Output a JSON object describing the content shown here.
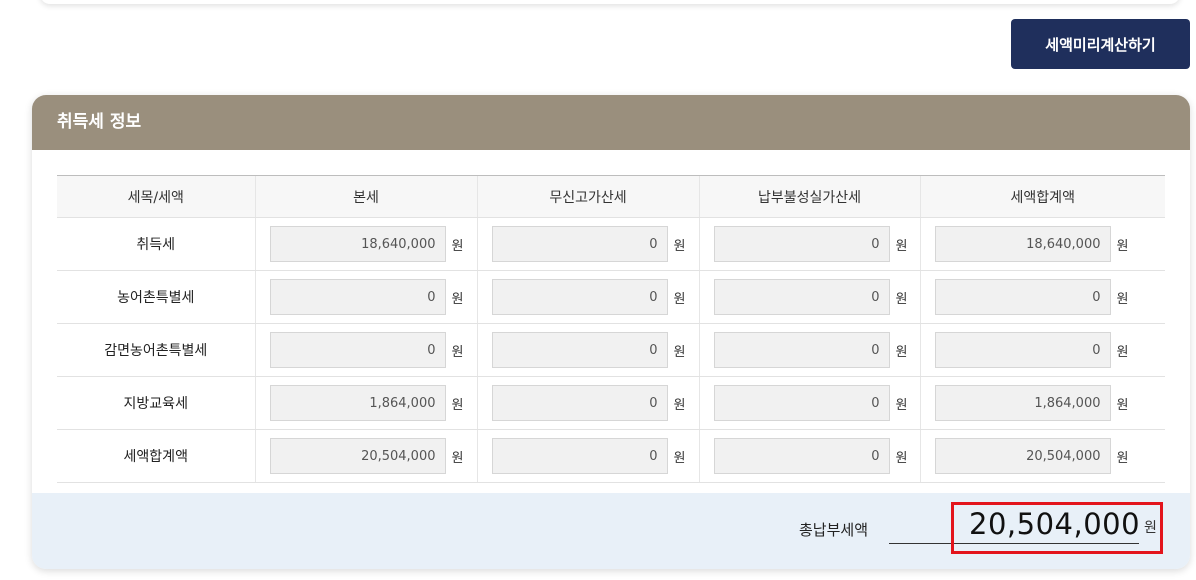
{
  "actions": {
    "calculate_label": "세액미리계산하기"
  },
  "panel": {
    "title": "취득세 정보"
  },
  "table": {
    "headers": [
      "세목/세액",
      "본세",
      "무신고가산세",
      "납부불성실가산세",
      "세액합계액"
    ],
    "unit": "원",
    "rows": [
      {
        "label": "취득세",
        "values": [
          "18,640,000",
          "0",
          "0",
          "18,640,000"
        ]
      },
      {
        "label": "농어촌특별세",
        "values": [
          "0",
          "0",
          "0",
          "0"
        ]
      },
      {
        "label": "감면농어촌특별세",
        "values": [
          "0",
          "0",
          "0",
          "0"
        ]
      },
      {
        "label": "지방교육세",
        "values": [
          "1,864,000",
          "0",
          "0",
          "1,864,000"
        ]
      },
      {
        "label": "세액합계액",
        "values": [
          "20,504,000",
          "0",
          "0",
          "20,504,000"
        ]
      }
    ]
  },
  "total": {
    "label": "총납부세액",
    "value": "20,504,000",
    "unit": "원",
    "highlight_color": "#e3141c"
  },
  "colors": {
    "button_bg": "#1f2f5c",
    "panel_header_bg": "#9a8f7d",
    "total_bar_bg": "#e8f0f8"
  }
}
